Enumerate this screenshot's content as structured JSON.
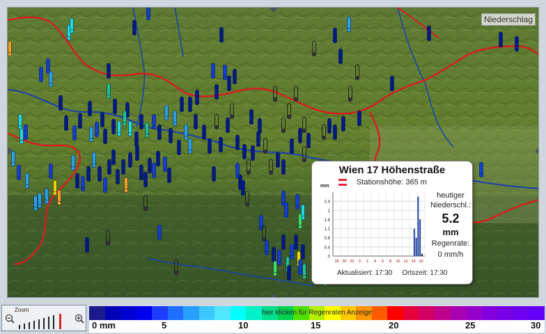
{
  "map": {
    "title": "Niederschlag"
  },
  "popup": {
    "station_name": "Wien 17 Höhenstraße",
    "station_height": "Stationshöhe: 365 m",
    "chart_unit": "mm",
    "today_label_line1": "heutiger",
    "today_label_line2": "Niederschl.:",
    "today_value": "5.2",
    "today_unit": "mm",
    "rate_label": "Regenrate:",
    "rate_value": "0 mm/h",
    "updated": "Aktualisiert: 17:30",
    "local_time": "Ortszeit: 17:30",
    "flag_colors": [
      "#ed2939",
      "#ffffff",
      "#ed2939"
    ]
  },
  "chart_data": {
    "type": "bar",
    "categories": [
      "18",
      "20",
      "22",
      "0",
      "2",
      "4",
      "6",
      "8",
      "10",
      "12",
      "14",
      "16"
    ],
    "ylim": [
      0,
      2.8
    ],
    "yticks": [
      "0",
      "0.4",
      "0.8",
      "1.2",
      "1.6",
      "2",
      "2.4"
    ],
    "ylabel": "mm",
    "values": [
      0,
      0,
      0,
      0,
      0,
      0,
      0,
      0,
      0,
      0,
      0,
      0,
      0,
      0,
      0,
      0,
      0,
      0,
      0,
      0,
      0,
      0,
      0,
      0,
      0,
      0,
      0,
      0,
      0,
      0,
      0,
      0,
      0,
      0,
      0,
      0,
      0,
      0,
      0,
      0,
      0,
      0,
      1.2,
      0.8,
      2.6,
      1.6,
      0.1,
      0
    ]
  },
  "zoom": {
    "label": "Zoom"
  },
  "legend": {
    "link_text": "hier klicken für Regenraten Anzeige",
    "labels": [
      "0 mm",
      "5",
      "10",
      "15",
      "20",
      "25",
      "30"
    ],
    "colors": [
      "#1a1a8c",
      "#0000b4",
      "#0000d2",
      "#0000f0",
      "#1e3cff",
      "#1e6eff",
      "#28a0ff",
      "#3cc8ff",
      "#50e6ff",
      "#00ffff",
      "#00f0c8",
      "#00e08c",
      "#00d050",
      "#50e000",
      "#b4f000",
      "#ffff00",
      "#ffc800",
      "#ff9600",
      "#ff5a00",
      "#ff0000",
      "#e6003c",
      "#d20064",
      "#be008c",
      "#aa00b4",
      "#9600c8",
      "#8200dc",
      "#7800e6",
      "#6e00f0",
      "#6400fa"
    ]
  },
  "markers_colors": {
    "navy": "#001a8a",
    "blue": "#1040d8",
    "sky": "#2aa0e8",
    "cyan": "#20d8e0",
    "teal": "#20c090",
    "green": "#40e060",
    "yellow": "#e8d800",
    "orange": "#f0a020",
    "empty": "#c8c8b0"
  }
}
